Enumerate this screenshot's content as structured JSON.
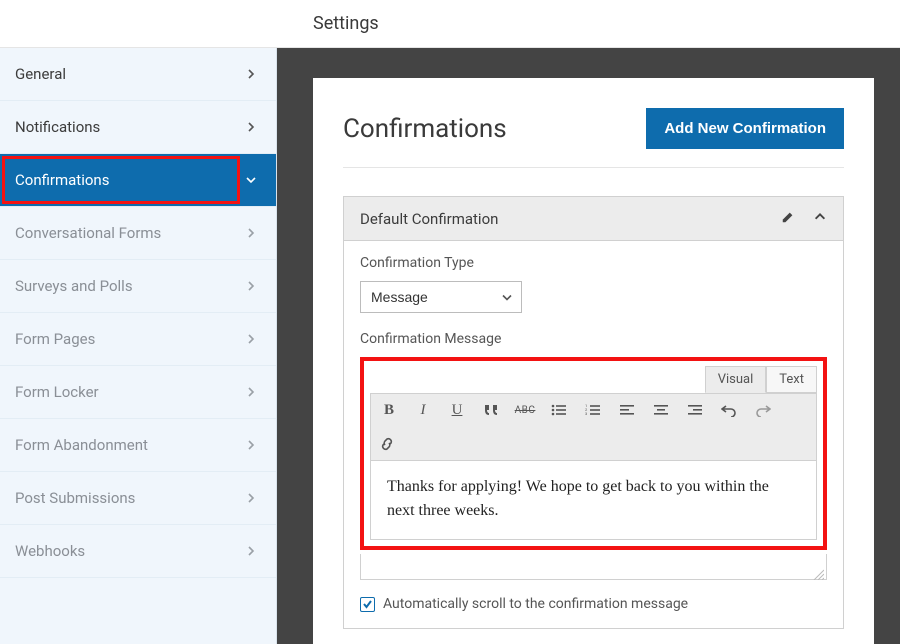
{
  "topbar": {
    "title": "Settings"
  },
  "sidebar": {
    "items": [
      {
        "label": "General",
        "active": false,
        "dim": false
      },
      {
        "label": "Notifications",
        "active": false,
        "dim": false
      },
      {
        "label": "Confirmations",
        "active": true,
        "dim": false
      },
      {
        "label": "Conversational Forms",
        "active": false,
        "dim": true
      },
      {
        "label": "Surveys and Polls",
        "active": false,
        "dim": true
      },
      {
        "label": "Form Pages",
        "active": false,
        "dim": true
      },
      {
        "label": "Form Locker",
        "active": false,
        "dim": true
      },
      {
        "label": "Form Abandonment",
        "active": false,
        "dim": true
      },
      {
        "label": "Post Submissions",
        "active": false,
        "dim": true
      },
      {
        "label": "Webhooks",
        "active": false,
        "dim": true
      }
    ]
  },
  "main": {
    "title": "Confirmations",
    "add_button": "Add New Confirmation",
    "panel_title": "Default Confirmation",
    "type_label": "Confirmation Type",
    "type_value": "Message",
    "message_label": "Confirmation Message",
    "tabs": {
      "visual": "Visual",
      "text": "Text",
      "active": "visual"
    },
    "editor_content": "Thanks for applying! We hope to get back to you within the next three weeks.",
    "scroll_checkbox": {
      "checked": true,
      "label": "Automatically scroll to the confirmation message"
    }
  },
  "colors": {
    "accent": "#0e6cad",
    "highlight": "#f31212"
  }
}
